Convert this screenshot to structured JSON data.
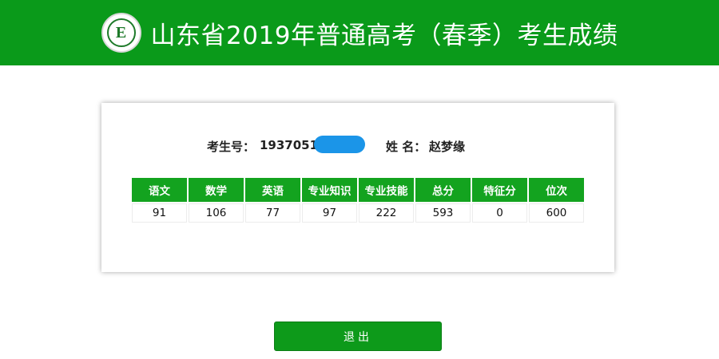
{
  "header": {
    "title": "山东省2019年普通高考（春季）考生成绩",
    "logo_letter": "E",
    "logo_icon": "school-seal-logo",
    "background_color": "#0a9a1a"
  },
  "student": {
    "id_label": "考生号：",
    "id_value": "1937051",
    "id_redacted": true,
    "name_label": "姓 名：",
    "name_value": "赵梦缘"
  },
  "scores": {
    "headers": [
      "语文",
      "数学",
      "英语",
      "专业知识",
      "专业技能",
      "总分",
      "特征分",
      "位次"
    ],
    "values": [
      "91",
      "106",
      "77",
      "97",
      "222",
      "593",
      "0",
      "600"
    ]
  },
  "actions": {
    "logout_label": "退出",
    "button_color": "#0d9a1a"
  }
}
